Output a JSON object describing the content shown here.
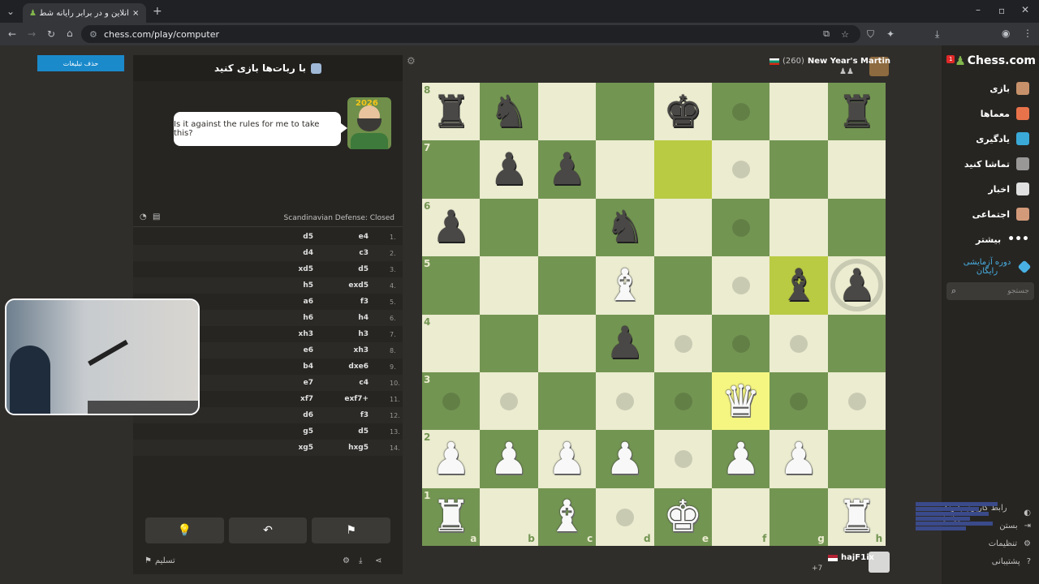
{
  "browser": {
    "tab_title": "آنلاین و در برابر رایانه شطرنج بازی",
    "url": "chess.com/play/computer"
  },
  "ads": {
    "remove_label": "حذف تبلیغات"
  },
  "panel": {
    "title": "با ربات‌ها بازی کنید",
    "bot_message": "Is it against the rules for me to take this?",
    "bot_badge": "2026",
    "opening": "Scandinavian Defense: Closed",
    "moves": [
      {
        "num": "1.",
        "white": "e4",
        "black": "d5"
      },
      {
        "num": "2.",
        "white": "c3",
        "black": "d4"
      },
      {
        "num": "3.",
        "white": "d5",
        "black": "xd5"
      },
      {
        "num": "4.",
        "white": "exd5",
        "black": "h5"
      },
      {
        "num": "5.",
        "white": "f3",
        "black": "a6"
      },
      {
        "num": "6.",
        "white": "h4",
        "black": "h6"
      },
      {
        "num": "7.",
        "white": "h3",
        "black": "xh3"
      },
      {
        "num": "8.",
        "white": "xh3",
        "black": "e6"
      },
      {
        "num": "9.",
        "white": "dxe6",
        "black": "b4"
      },
      {
        "num": "10.",
        "white": "c4",
        "black": "e7"
      },
      {
        "num": "11.",
        "white": "exf7+",
        "black": "xf7"
      },
      {
        "num": "12.",
        "white": "f3",
        "black": "d6"
      },
      {
        "num": "13.",
        "white": "d5",
        "black": "g5"
      },
      {
        "num": "14.",
        "white": "hxg5",
        "black": "xg5"
      }
    ],
    "resign_label": "تسلیم"
  },
  "opponent": {
    "name": "New Year's Martin",
    "rating": "(260)"
  },
  "player": {
    "name": "hajF1ix",
    "extra": "+7"
  },
  "board": {
    "ranks": [
      "8",
      "7",
      "6",
      "5",
      "4",
      "3",
      "2",
      "1"
    ],
    "files": [
      "a",
      "b",
      "c",
      "d",
      "e",
      "f",
      "g",
      "h"
    ],
    "pieces": [
      {
        "sq": "a8",
        "p": "♜",
        "c": "b"
      },
      {
        "sq": "b8",
        "p": "♞",
        "c": "b"
      },
      {
        "sq": "e8",
        "p": "♚",
        "c": "b"
      },
      {
        "sq": "h8",
        "p": "♜",
        "c": "b"
      },
      {
        "sq": "b7",
        "p": "♟",
        "c": "b"
      },
      {
        "sq": "c7",
        "p": "♟",
        "c": "b"
      },
      {
        "sq": "a6",
        "p": "♟",
        "c": "b"
      },
      {
        "sq": "d6",
        "p": "♞",
        "c": "b"
      },
      {
        "sq": "d5",
        "p": "♝",
        "c": "w"
      },
      {
        "sq": "g5",
        "p": "♝",
        "c": "b"
      },
      {
        "sq": "h5",
        "p": "♟",
        "c": "b"
      },
      {
        "sq": "d4",
        "p": "♟",
        "c": "b"
      },
      {
        "sq": "f3",
        "p": "♛",
        "c": "w"
      },
      {
        "sq": "a2",
        "p": "♟",
        "c": "w"
      },
      {
        "sq": "b2",
        "p": "♟",
        "c": "w"
      },
      {
        "sq": "c2",
        "p": "♟",
        "c": "w"
      },
      {
        "sq": "d2",
        "p": "♟",
        "c": "w"
      },
      {
        "sq": "f2",
        "p": "♟",
        "c": "w"
      },
      {
        "sq": "g2",
        "p": "♟",
        "c": "w"
      },
      {
        "sq": "a1",
        "p": "♜",
        "c": "w"
      },
      {
        "sq": "c1",
        "p": "♝",
        "c": "w"
      },
      {
        "sq": "e1",
        "p": "♚",
        "c": "w"
      },
      {
        "sq": "h1",
        "p": "♜",
        "c": "w"
      }
    ],
    "highlights": [
      "e7",
      "g5",
      "f3"
    ],
    "dots": [
      "f8",
      "f7",
      "f6",
      "f5",
      "e4",
      "f4",
      "g4",
      "a3",
      "b3",
      "d3",
      "e3",
      "g3",
      "h3",
      "e2",
      "d1"
    ],
    "rings": [
      "h5"
    ]
  },
  "nav": {
    "brand": "Chess.com",
    "notification_count": "1",
    "items": [
      "بازی",
      "معماها",
      "یادگیری",
      "تماشا کنید",
      "اخبار",
      "اجتماعی",
      "بیشتر",
      "دوره آزمایشی رایگان"
    ],
    "search_placeholder": "جستجو",
    "bottom": [
      "رابط کاربری با رنگ روشن",
      "بستن",
      "تنظیمات",
      "پشتیبانی"
    ]
  },
  "colors": {
    "light_square": "#ebecd0",
    "dark_square": "#739552",
    "accent": "#1b8acb"
  }
}
